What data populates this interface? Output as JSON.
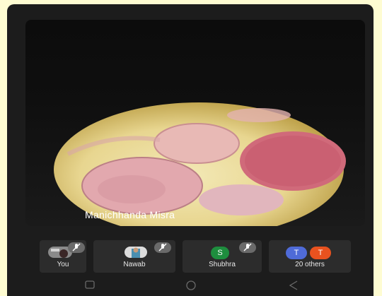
{
  "speaker": {
    "name": "Manichhanda Misra"
  },
  "participants": [
    {
      "label": "You",
      "avatar_type": "photo",
      "muted": true
    },
    {
      "label": "Nawab",
      "avatar_type": "photo",
      "muted": true
    },
    {
      "label": "Shubhra",
      "avatar_letter": "S",
      "avatar_color": "#1e8e3e",
      "muted": true
    },
    {
      "label": "20 others",
      "avatars": [
        {
          "letter": "T",
          "color": "#4f6bd8"
        },
        {
          "letter": "T",
          "color": "#e8521f"
        }
      ]
    }
  ],
  "nav": {
    "icons": [
      "recents-icon",
      "home-icon",
      "back-icon"
    ]
  }
}
